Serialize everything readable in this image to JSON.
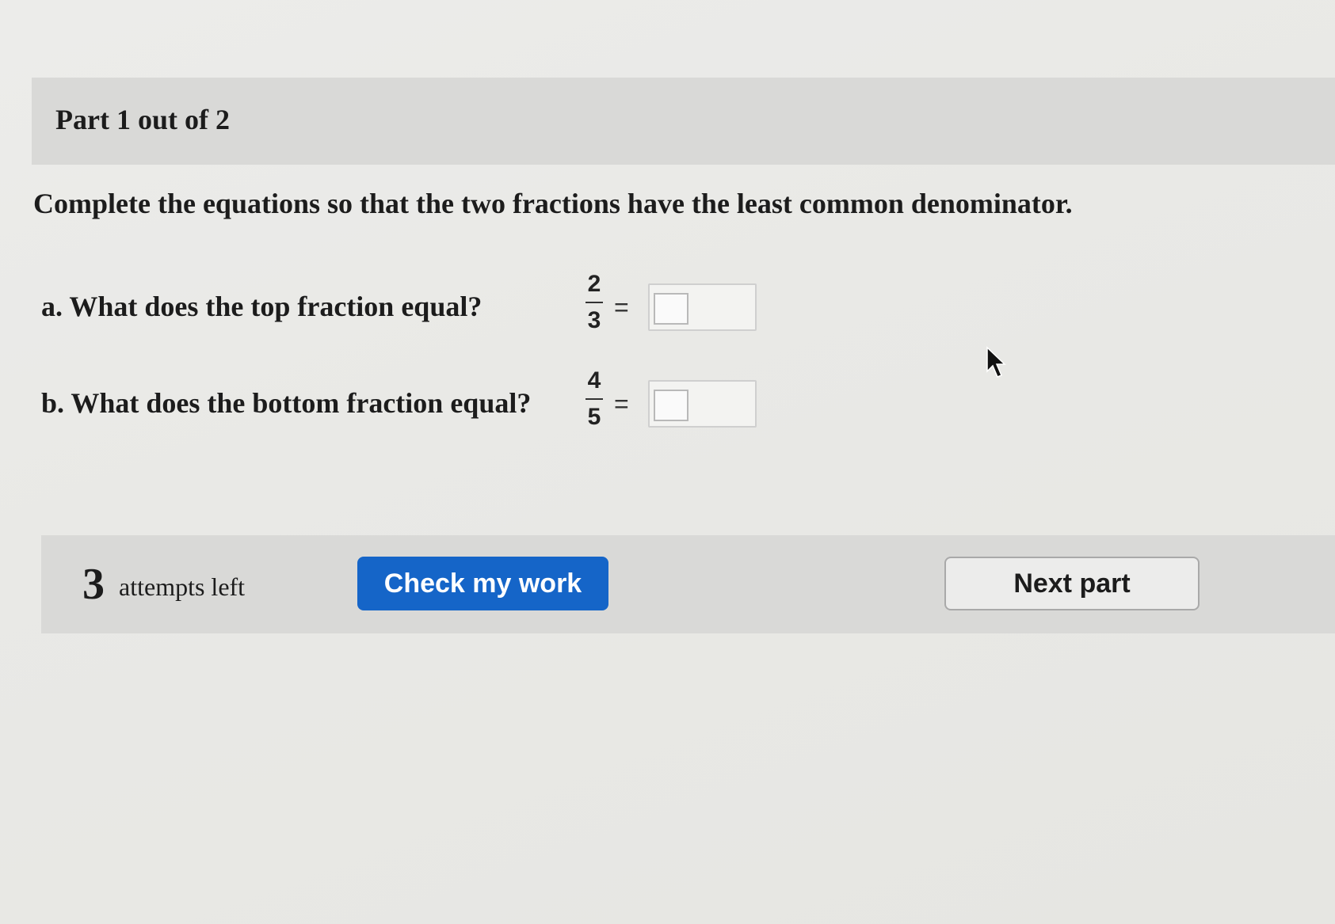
{
  "header": {
    "part_label": "Part 1 out of 2"
  },
  "instructions": "Complete the equations so that the two fractions have the least common denominator.",
  "questions": [
    {
      "label": "a. What does the top fraction equal?",
      "numerator": "2",
      "denominator": "3",
      "equals": "=",
      "answer_value": ""
    },
    {
      "label": "b. What does the bottom fraction equal?",
      "numerator": "4",
      "denominator": "5",
      "equals": "=",
      "answer_value": ""
    }
  ],
  "footer": {
    "attempts_count": "3",
    "attempts_text": "attempts left",
    "check_button_label": "Check my work",
    "next_button_label": "Next part"
  },
  "colors": {
    "primary_button": "#1565c8",
    "header_band": "#d9d9d7"
  },
  "icons": {
    "cursor": "mouse-pointer-icon"
  }
}
